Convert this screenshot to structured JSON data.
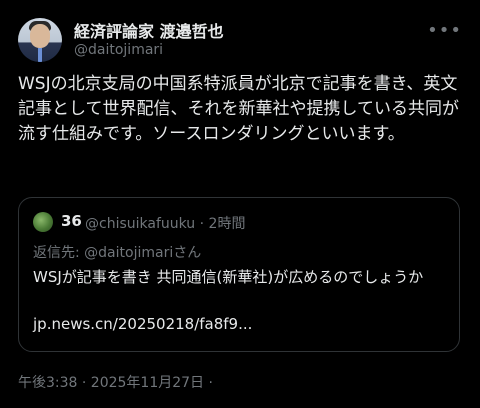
{
  "author": {
    "name": "経済評論家 渡邉哲也",
    "handle": "@daitojimari"
  },
  "more_icon": "more-horizontal-icon",
  "tweet": {
    "text": "WSJの北京支局の中国系特派員が北京で記事を書き、英文記事として世界配信、それを新華社や提携している共同が流す仕組みです。ソースロンダリングといいます。"
  },
  "quoted": {
    "name": "36",
    "meta": "@chisuikafuuku · 2時間",
    "reply_to": "返信先: @daitojimariさん",
    "text": "WSJが記事を書き 共同通信(新華社)が広めるのでしょうか",
    "link": "jp.news.cn/20250218/fa8f9..."
  },
  "timestamp": "午後3:38 · 2025年11月27日 ·"
}
